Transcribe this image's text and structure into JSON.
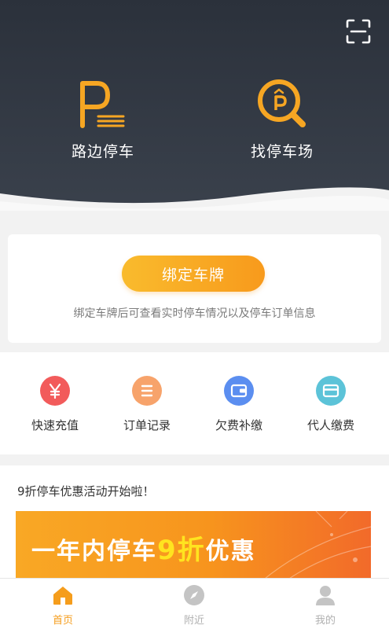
{
  "hero": {
    "scan_icon": "scan-icon",
    "items": [
      {
        "label": "路边停车",
        "icon": "roadside-parking-icon"
      },
      {
        "label": "找停车场",
        "icon": "find-parking-lot-icon"
      }
    ],
    "accent": "#f6a623",
    "background": "#2f353f"
  },
  "bind_card": {
    "button_label": "绑定车牌",
    "hint": "绑定车牌后可查看实时停车情况以及停车订单信息"
  },
  "actions": [
    {
      "label": "快速充值",
      "icon": "yen-recharge-icon",
      "color": "#f25b5b"
    },
    {
      "label": "订单记录",
      "icon": "order-list-icon",
      "color": "#f7a36b"
    },
    {
      "label": "欠费补缴",
      "icon": "wallet-icon",
      "color": "#5b8ef0"
    },
    {
      "label": "代人缴费",
      "icon": "card-icon",
      "color": "#5cc3d8"
    }
  ],
  "promo": {
    "title": "9折停车优惠活动开始啦！",
    "banner_prefix": "一年内停车",
    "banner_highlight": "9折",
    "banner_suffix": "优惠"
  },
  "tabbar": {
    "active_color": "#f59d1c",
    "items": [
      {
        "label": "首页",
        "icon": "home-icon",
        "active": true
      },
      {
        "label": "附近",
        "icon": "compass-icon",
        "active": false
      },
      {
        "label": "我的",
        "icon": "user-icon",
        "active": false
      }
    ]
  }
}
